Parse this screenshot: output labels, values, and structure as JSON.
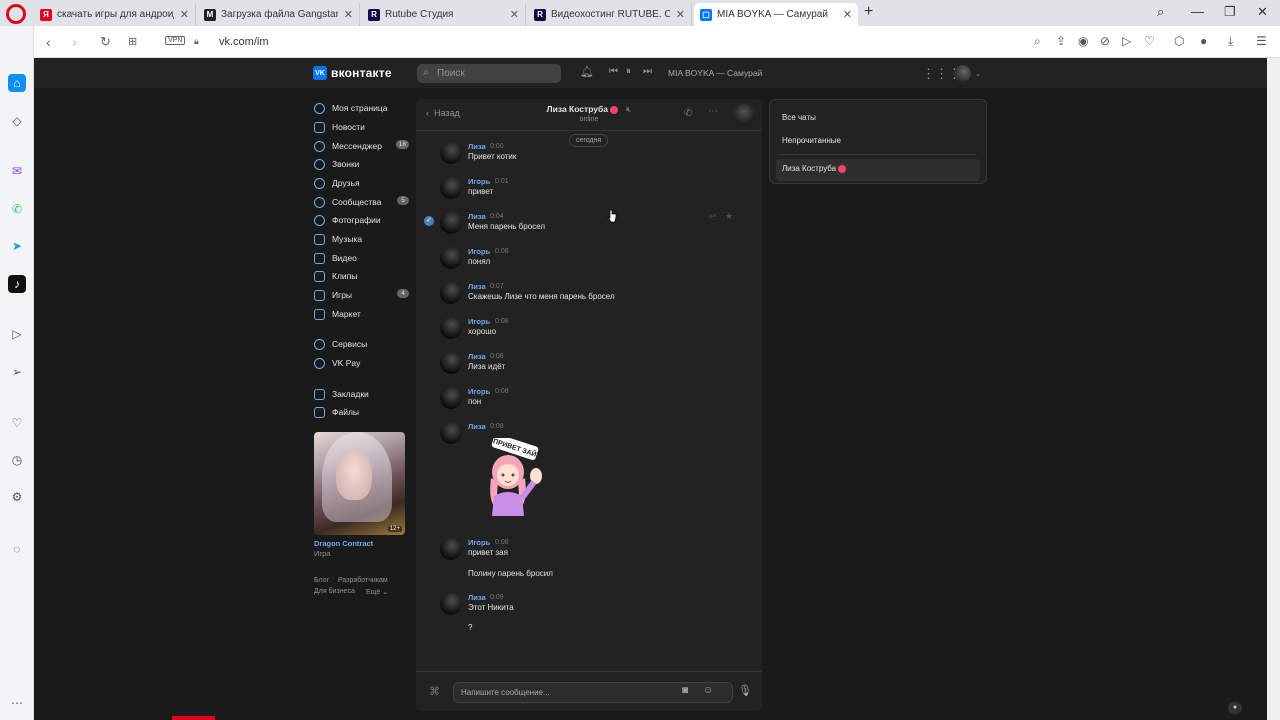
{
  "browser": {
    "tabs": [
      {
        "label": "скачать игры для андроид",
        "favicon": "Я",
        "color": "#e0001b"
      },
      {
        "label": "Загрузка файла Gangstar",
        "favicon": "M",
        "color": "#222222"
      },
      {
        "label": "Rutube Студия",
        "favicon": "R",
        "color": "#100943"
      },
      {
        "label": "Видеохостинг RUTUBE. Сс",
        "favicon": "R",
        "color": "#100943"
      },
      {
        "label": "MIA BOYKA — Самурай",
        "favicon": "▢",
        "color": "#0077ff"
      }
    ],
    "url": "vk.com/im",
    "vpn_label": "VPN"
  },
  "vk": {
    "logo_text": "вконтакте",
    "logo_box": "VK",
    "search_placeholder": "Поиск",
    "now_playing": "MIA BOYKA — Самурай"
  },
  "sidebar": {
    "items": [
      {
        "label": "Моя страница",
        "count": ""
      },
      {
        "label": "Новости",
        "count": ""
      },
      {
        "label": "Мессенджер",
        "count": "18"
      },
      {
        "label": "Звонки",
        "count": ""
      },
      {
        "label": "Друзья",
        "count": ""
      },
      {
        "label": "Сообщества",
        "count": "5"
      },
      {
        "label": "Фотографии",
        "count": ""
      },
      {
        "label": "Музыка",
        "count": ""
      },
      {
        "label": "Видео",
        "count": ""
      },
      {
        "label": "Клипы",
        "count": ""
      },
      {
        "label": "Игры",
        "count": "4"
      },
      {
        "label": "Маркет",
        "count": ""
      },
      {
        "label": "Сервисы",
        "count": ""
      },
      {
        "label": "VK Pay",
        "count": ""
      },
      {
        "label": "Закладки",
        "count": ""
      },
      {
        "label": "Файлы",
        "count": ""
      }
    ],
    "ad_title": "Dragon Contract",
    "ad_sub": "Игра",
    "ad_age": "12+",
    "footer": [
      "Блог",
      "Разработчикам",
      "Для бизнеса",
      "Ещё ⌄"
    ]
  },
  "chat": {
    "back": "Назад",
    "name": "Лиза Коструба",
    "status": "online",
    "date": "сегодня",
    "messages": [
      {
        "name": "Лиза",
        "time": "0:00",
        "text": "Привет котик"
      },
      {
        "name": "Игорь",
        "time": "0:01",
        "text": "привет"
      },
      {
        "name": "Лиза",
        "time": "0:04",
        "text": "Меня парень бросел"
      },
      {
        "name": "Игорь",
        "time": "0:06",
        "text": "понял"
      },
      {
        "name": "Лиза",
        "time": "0:07",
        "text": "Скажешь Лизе что меня парень бросел"
      },
      {
        "name": "Игорь",
        "time": "0:08",
        "text": "хорошо"
      },
      {
        "name": "Лиза",
        "time": "0:08",
        "text": "Лиза идёт"
      },
      {
        "name": "Игорь",
        "time": "0:08",
        "text": "пон"
      },
      {
        "name": "Лиза",
        "time": "0:08",
        "text": ""
      },
      {
        "name": "Игорь",
        "time": "0:08",
        "text": "привет зая"
      },
      {
        "name": "Лиза",
        "time": "0:09",
        "text": "Этот Никита"
      }
    ],
    "extra_1": "Полину парень бросил",
    "extra_2": "?",
    "sticker_text": "ПРИВЕТ ЗАЙ",
    "composer_placeholder": "Напишите сообщение..."
  },
  "right_panel": {
    "all": "Все чаты",
    "unread": "Непрочитанные",
    "selected": "Лиза Коструба"
  }
}
